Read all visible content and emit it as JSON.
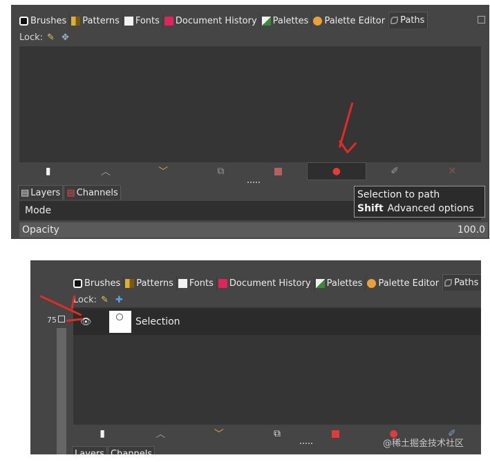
{
  "top": {
    "tabs": [
      {
        "label": "Brushes",
        "icon": "brushes-icon"
      },
      {
        "label": "Patterns",
        "icon": "patterns-icon"
      },
      {
        "label": "Fonts",
        "icon": "fonts-icon"
      },
      {
        "label": "Document History",
        "icon": "document-history-icon"
      },
      {
        "label": "Palettes",
        "icon": "palettes-icon"
      },
      {
        "label": "Palette Editor",
        "icon": "palette-editor-icon"
      },
      {
        "label": "Paths",
        "icon": "paths-icon"
      }
    ],
    "lock_label": "Lock:",
    "tooltip_title": "Selection to path",
    "tooltip_key": "Shift",
    "tooltip_text": "Advanced options",
    "bottom_tabs": [
      {
        "label": "Layers"
      },
      {
        "label": "Channels"
      }
    ],
    "mode_label": "Mode",
    "opacity_label": "Opacity",
    "opacity_value": "100.0"
  },
  "bottom": {
    "tabs": [
      {
        "label": "Brushes"
      },
      {
        "label": "Patterns"
      },
      {
        "label": "Fonts"
      },
      {
        "label": "Document History"
      },
      {
        "label": "Palettes"
      },
      {
        "label": "Palette Editor"
      },
      {
        "label": "Paths"
      }
    ],
    "lock_label": "Lock:",
    "path_name": "Selection",
    "ruler_label": "75",
    "bottom_tabs": [
      {
        "label": "Layers"
      },
      {
        "label": "Channels"
      }
    ],
    "watermark": "@稀土掘金技术社区"
  },
  "colors": {
    "accent_arrow": "#e52a23",
    "panel_bg": "#454545",
    "list_bg": "#353535"
  }
}
